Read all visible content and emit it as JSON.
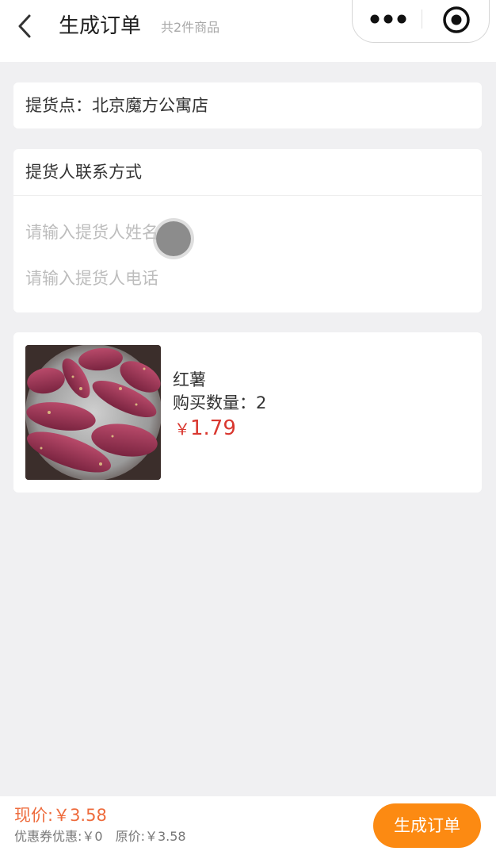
{
  "header": {
    "title": "生成订单",
    "subtitle": "共2件商品",
    "back_icon": "chevron-left-icon",
    "more_icon": "more-dots-icon",
    "close_icon": "target-icon"
  },
  "pickup": {
    "text": "提货点：北京魔方公寓店"
  },
  "contact": {
    "heading": "提货人联系方式",
    "name_placeholder": "请输入提货人姓名",
    "name_value": "",
    "phone_placeholder": "请输入提货人电话",
    "phone_value": ""
  },
  "product": {
    "name": "红薯",
    "quantity_text": "购买数量：2",
    "currency": "￥",
    "price": "1.79",
    "image_icon": "sweet-potato-photo"
  },
  "footer": {
    "current_price": "现价:￥3.58",
    "coupon_text": "优惠券优惠:￥0",
    "original_text": "原价:￥3.58",
    "submit_label": "生成订单"
  },
  "colors": {
    "price_red": "#d9372f",
    "current_price_orange": "#ee6b3c",
    "button_orange": "#fc8a12",
    "background": "#f0f0f2"
  }
}
